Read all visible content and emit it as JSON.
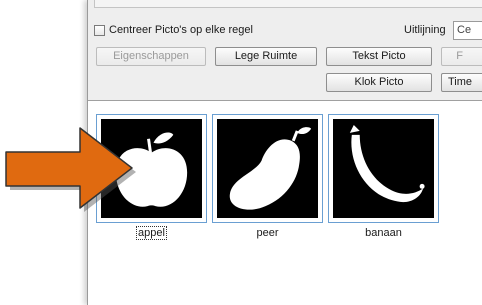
{
  "toolbar": {
    "center_checkbox_label": "Centreer Picto's op elke regel",
    "alignment_label": "Uitlijning",
    "alignment_value": "Ce",
    "buttons": {
      "properties": "Eigenschappen",
      "empty_space": "Lege Ruimte",
      "text_picto": "Tekst Picto",
      "clock_picto": "Klok Picto",
      "partial_right_top": "F",
      "partial_right_bottom": "Time"
    }
  },
  "pictos": [
    {
      "label": "appel",
      "icon": "apple-icon",
      "selected": true
    },
    {
      "label": "peer",
      "icon": "pear-icon",
      "selected": false
    },
    {
      "label": "banaan",
      "icon": "banana-icon",
      "selected": false
    }
  ],
  "colors": {
    "arrow": "#e06a10",
    "arrow_border": "#333333",
    "selection_border": "#6a9fd2"
  }
}
